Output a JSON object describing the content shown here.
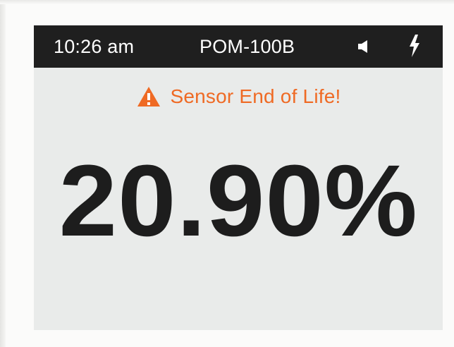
{
  "status_bar": {
    "time": "10:26 am",
    "device_name": "POM-100B",
    "speaker_icon": "speaker-icon",
    "power_icon": "lightning-bolt-icon",
    "background_color": "#1f1f1f",
    "text_color": "#ffffff"
  },
  "alert": {
    "icon": "warning-icon",
    "text": "Sensor End of Life!",
    "color": "#ef6a24"
  },
  "reading": {
    "value": "20.90%",
    "color": "#1d1d1d"
  },
  "screen": {
    "background_color": "#e9ebea"
  }
}
